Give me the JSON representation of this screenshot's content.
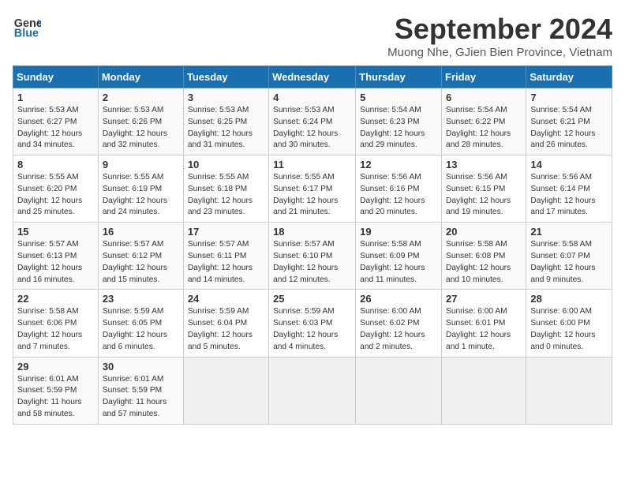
{
  "logo": {
    "line1": "General",
    "line2": "Blue"
  },
  "title": "September 2024",
  "location": "Muong Nhe, GJien Bien Province, Vietnam",
  "days_header": [
    "Sunday",
    "Monday",
    "Tuesday",
    "Wednesday",
    "Thursday",
    "Friday",
    "Saturday"
  ],
  "weeks": [
    [
      {
        "day": "1",
        "info": "Sunrise: 5:53 AM\nSunset: 6:27 PM\nDaylight: 12 hours\nand 34 minutes."
      },
      {
        "day": "2",
        "info": "Sunrise: 5:53 AM\nSunset: 6:26 PM\nDaylight: 12 hours\nand 32 minutes."
      },
      {
        "day": "3",
        "info": "Sunrise: 5:53 AM\nSunset: 6:25 PM\nDaylight: 12 hours\nand 31 minutes."
      },
      {
        "day": "4",
        "info": "Sunrise: 5:53 AM\nSunset: 6:24 PM\nDaylight: 12 hours\nand 30 minutes."
      },
      {
        "day": "5",
        "info": "Sunrise: 5:54 AM\nSunset: 6:23 PM\nDaylight: 12 hours\nand 29 minutes."
      },
      {
        "day": "6",
        "info": "Sunrise: 5:54 AM\nSunset: 6:22 PM\nDaylight: 12 hours\nand 28 minutes."
      },
      {
        "day": "7",
        "info": "Sunrise: 5:54 AM\nSunset: 6:21 PM\nDaylight: 12 hours\nand 26 minutes."
      }
    ],
    [
      {
        "day": "8",
        "info": "Sunrise: 5:55 AM\nSunset: 6:20 PM\nDaylight: 12 hours\nand 25 minutes."
      },
      {
        "day": "9",
        "info": "Sunrise: 5:55 AM\nSunset: 6:19 PM\nDaylight: 12 hours\nand 24 minutes."
      },
      {
        "day": "10",
        "info": "Sunrise: 5:55 AM\nSunset: 6:18 PM\nDaylight: 12 hours\nand 23 minutes."
      },
      {
        "day": "11",
        "info": "Sunrise: 5:55 AM\nSunset: 6:17 PM\nDaylight: 12 hours\nand 21 minutes."
      },
      {
        "day": "12",
        "info": "Sunrise: 5:56 AM\nSunset: 6:16 PM\nDaylight: 12 hours\nand 20 minutes."
      },
      {
        "day": "13",
        "info": "Sunrise: 5:56 AM\nSunset: 6:15 PM\nDaylight: 12 hours\nand 19 minutes."
      },
      {
        "day": "14",
        "info": "Sunrise: 5:56 AM\nSunset: 6:14 PM\nDaylight: 12 hours\nand 17 minutes."
      }
    ],
    [
      {
        "day": "15",
        "info": "Sunrise: 5:57 AM\nSunset: 6:13 PM\nDaylight: 12 hours\nand 16 minutes."
      },
      {
        "day": "16",
        "info": "Sunrise: 5:57 AM\nSunset: 6:12 PM\nDaylight: 12 hours\nand 15 minutes."
      },
      {
        "day": "17",
        "info": "Sunrise: 5:57 AM\nSunset: 6:11 PM\nDaylight: 12 hours\nand 14 minutes."
      },
      {
        "day": "18",
        "info": "Sunrise: 5:57 AM\nSunset: 6:10 PM\nDaylight: 12 hours\nand 12 minutes."
      },
      {
        "day": "19",
        "info": "Sunrise: 5:58 AM\nSunset: 6:09 PM\nDaylight: 12 hours\nand 11 minutes."
      },
      {
        "day": "20",
        "info": "Sunrise: 5:58 AM\nSunset: 6:08 PM\nDaylight: 12 hours\nand 10 minutes."
      },
      {
        "day": "21",
        "info": "Sunrise: 5:58 AM\nSunset: 6:07 PM\nDaylight: 12 hours\nand 9 minutes."
      }
    ],
    [
      {
        "day": "22",
        "info": "Sunrise: 5:58 AM\nSunset: 6:06 PM\nDaylight: 12 hours\nand 7 minutes."
      },
      {
        "day": "23",
        "info": "Sunrise: 5:59 AM\nSunset: 6:05 PM\nDaylight: 12 hours\nand 6 minutes."
      },
      {
        "day": "24",
        "info": "Sunrise: 5:59 AM\nSunset: 6:04 PM\nDaylight: 12 hours\nand 5 minutes."
      },
      {
        "day": "25",
        "info": "Sunrise: 5:59 AM\nSunset: 6:03 PM\nDaylight: 12 hours\nand 4 minutes."
      },
      {
        "day": "26",
        "info": "Sunrise: 6:00 AM\nSunset: 6:02 PM\nDaylight: 12 hours\nand 2 minutes."
      },
      {
        "day": "27",
        "info": "Sunrise: 6:00 AM\nSunset: 6:01 PM\nDaylight: 12 hours\nand 1 minute."
      },
      {
        "day": "28",
        "info": "Sunrise: 6:00 AM\nSunset: 6:00 PM\nDaylight: 12 hours\nand 0 minutes."
      }
    ],
    [
      {
        "day": "29",
        "info": "Sunrise: 6:01 AM\nSunset: 5:59 PM\nDaylight: 11 hours\nand 58 minutes."
      },
      {
        "day": "30",
        "info": "Sunrise: 6:01 AM\nSunset: 5:59 PM\nDaylight: 11 hours\nand 57 minutes."
      },
      null,
      null,
      null,
      null,
      null
    ]
  ]
}
